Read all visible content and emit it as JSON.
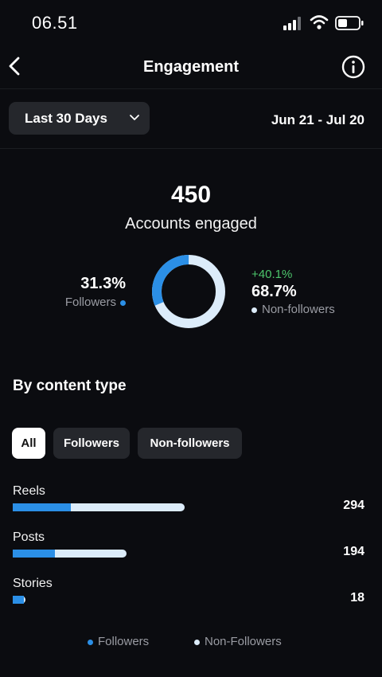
{
  "status_bar": {
    "time": "06.51"
  },
  "nav": {
    "title": "Engagement"
  },
  "filter": {
    "range_label": "Last 30 Days",
    "date_range": "Jun 21 - Jul 20"
  },
  "summary": {
    "count": "450",
    "label": "Accounts engaged",
    "followers_pct": "31.3%",
    "followers_label": "Followers",
    "nonfollowers_change": "+40.1%",
    "nonfollowers_pct": "68.7%",
    "nonfollowers_label": "Non-followers",
    "followers_share": 0.313
  },
  "content_type": {
    "title": "By content type",
    "tabs": [
      "All",
      "Followers",
      "Non-followers"
    ],
    "selected_tab": "All",
    "rows": [
      {
        "label": "Reels",
        "value": "294",
        "total": 294,
        "followers_fraction": 0.34
      },
      {
        "label": "Posts",
        "value": "194",
        "total": 194,
        "followers_fraction": 0.37
      },
      {
        "label": "Stories",
        "value": "18",
        "total": 18,
        "followers_fraction": 0.85
      }
    ],
    "legend": [
      "Followers",
      "Non-Followers"
    ]
  },
  "colors": {
    "followers": "#2b8fe6",
    "nonfollowers": "#dcecfa",
    "positive_change": "#4cc56b",
    "background": "#0b0c10"
  },
  "icons": [
    "back-icon",
    "info-icon",
    "chevron-down-icon",
    "signal-icon",
    "wifi-icon",
    "battery-icon"
  ]
}
